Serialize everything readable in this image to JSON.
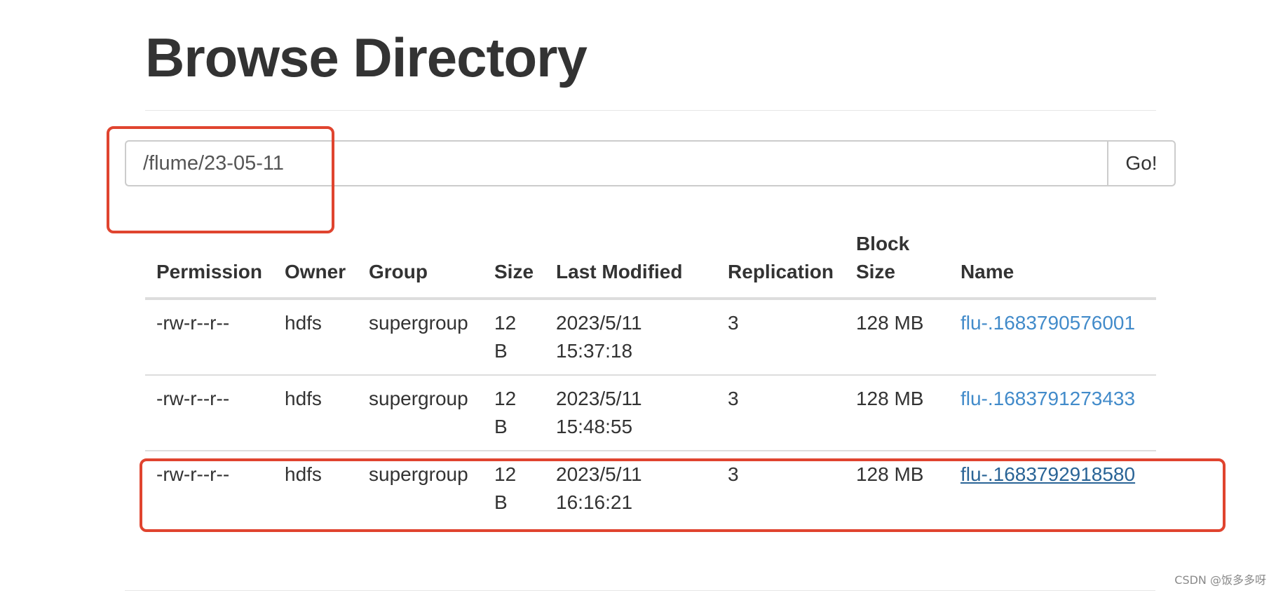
{
  "page": {
    "title": "Browse Directory"
  },
  "path_bar": {
    "value": "/flume/23-05-11",
    "go_label": "Go!"
  },
  "table": {
    "headers": {
      "permission": "Permission",
      "owner": "Owner",
      "group": "Group",
      "size": "Size",
      "last_modified": "Last Modified",
      "replication": "Replication",
      "block_size": "Block Size",
      "name": "Name"
    },
    "rows": [
      {
        "permission": "-rw-r--r--",
        "owner": "hdfs",
        "group": "supergroup",
        "size": "12 B",
        "last_modified": "2023/5/11 15:37:18",
        "replication": "3",
        "block_size": "128 MB",
        "name": "flu-.1683790576001"
      },
      {
        "permission": "-rw-r--r--",
        "owner": "hdfs",
        "group": "supergroup",
        "size": "12 B",
        "last_modified": "2023/5/11 15:48:55",
        "replication": "3",
        "block_size": "128 MB",
        "name": "flu-.1683791273433"
      },
      {
        "permission": "-rw-r--r--",
        "owner": "hdfs",
        "group": "supergroup",
        "size": "12 B",
        "last_modified": "2023/5/11 16:16:21",
        "replication": "3",
        "block_size": "128 MB",
        "name": "flu-.1683792918580"
      }
    ]
  },
  "watermark": "CSDN @饭多多呀",
  "colors": {
    "annotation_red": "#e0442f",
    "link_blue": "#428bca",
    "link_active": "#2a6496"
  }
}
